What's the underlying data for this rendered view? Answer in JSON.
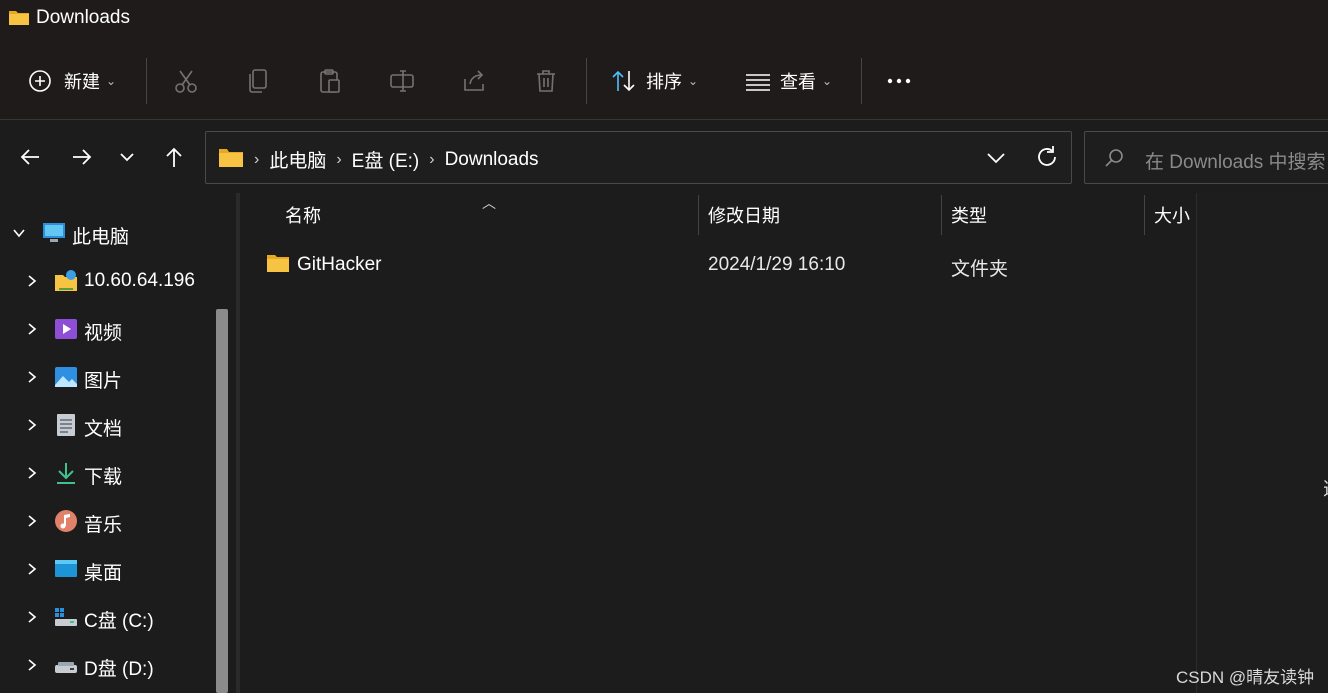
{
  "window": {
    "title": "Downloads"
  },
  "toolbar": {
    "new_label": "新建",
    "sort_label": "排序",
    "view_label": "查看",
    "icons": [
      "plus-circle-icon",
      "cut-icon",
      "copy-icon",
      "paste-icon",
      "rename-icon",
      "share-icon",
      "delete-icon",
      "sort-icon",
      "view-icon",
      "more-icon"
    ]
  },
  "address": {
    "breadcrumbs": [
      "此电脑",
      "E盘 (E:)",
      "Downloads"
    ]
  },
  "search": {
    "placeholder": "在 Downloads 中搜索"
  },
  "sidebar": {
    "root_label": "此电脑",
    "items": [
      {
        "label": "10.60.64.196",
        "icon": "network-drive-icon"
      },
      {
        "label": "视频",
        "icon": "videos-icon"
      },
      {
        "label": "图片",
        "icon": "pictures-icon"
      },
      {
        "label": "文档",
        "icon": "documents-icon"
      },
      {
        "label": "下载",
        "icon": "downloads-icon"
      },
      {
        "label": "音乐",
        "icon": "music-icon"
      },
      {
        "label": "桌面",
        "icon": "desktop-icon"
      },
      {
        "label": "C盘 (C:)",
        "icon": "drive-c-icon"
      },
      {
        "label": "D盘 (D:)",
        "icon": "drive-d-icon"
      }
    ]
  },
  "columns": {
    "name": "名称",
    "modified": "修改日期",
    "type": "类型",
    "size": "大小"
  },
  "files": [
    {
      "name": "GitHacker",
      "modified": "2024/1/29 16:10",
      "type": "文件夹",
      "size": ""
    }
  ],
  "preview": {
    "partial_glyph": "选"
  },
  "watermark": "CSDN @晴友读钟",
  "colors": {
    "folder": "#f6c343",
    "accent": "#4cc2ff",
    "chrome": "#201b1b",
    "background": "#1c1c1c"
  }
}
